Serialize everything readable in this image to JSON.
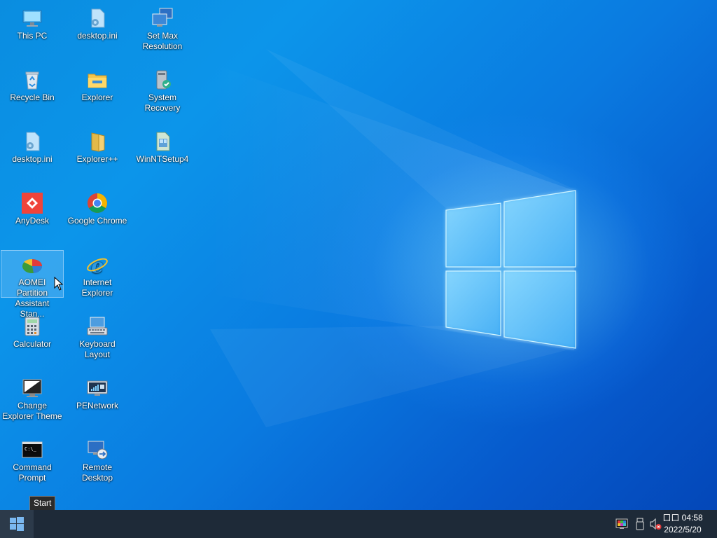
{
  "desktop": {
    "icons": [
      {
        "label": "This PC",
        "icon": "computer-icon"
      },
      {
        "label": "desktop.ini",
        "icon": "settings-file-icon"
      },
      {
        "label": "Set Max Resolution",
        "icon": "display-settings-icon"
      },
      {
        "label": "Recycle Bin",
        "icon": "recycle-bin-icon"
      },
      {
        "label": "Explorer",
        "icon": "folder-icon"
      },
      {
        "label": "System Recovery",
        "icon": "system-recovery-icon"
      },
      {
        "label": "desktop.ini",
        "icon": "settings-file-icon"
      },
      {
        "label": "Explorer++",
        "icon": "folder-icon"
      },
      {
        "label": "WinNTSetup4",
        "icon": "setup-icon"
      },
      {
        "label": "AnyDesk",
        "icon": "anydesk-icon"
      },
      {
        "label": "Google Chrome",
        "icon": "chrome-icon"
      },
      {
        "label": "AOMEI Partition Assistant Stan...",
        "icon": "partition-icon"
      },
      {
        "label": "Internet Explorer",
        "icon": "internet-explorer-icon"
      },
      {
        "label": "Calculator",
        "icon": "calculator-icon"
      },
      {
        "label": "Keyboard Layout",
        "icon": "keyboard-icon"
      },
      {
        "label": "Change Explorer Theme",
        "icon": "theme-icon"
      },
      {
        "label": "PENetwork",
        "icon": "network-icon"
      },
      {
        "label": "Command Prompt",
        "icon": "command-prompt-icon"
      },
      {
        "label": "Remote Desktop",
        "icon": "remote-desktop-icon"
      }
    ],
    "selected_icon": "AOMEI Partition Assistant Stan..."
  },
  "tooltip": {
    "text": "Start"
  },
  "taskbar": {
    "start_label": "Start",
    "tray": [
      "color-display-icon",
      "usb-icon",
      "volume-muted-icon"
    ],
    "clock": {
      "time": "口口 04:58",
      "date": "2022/5/20"
    }
  },
  "colors": {
    "taskbar": "#1e2a38",
    "desktop_blue": "#0a8de0",
    "start_logo": "#7ab8f0"
  }
}
